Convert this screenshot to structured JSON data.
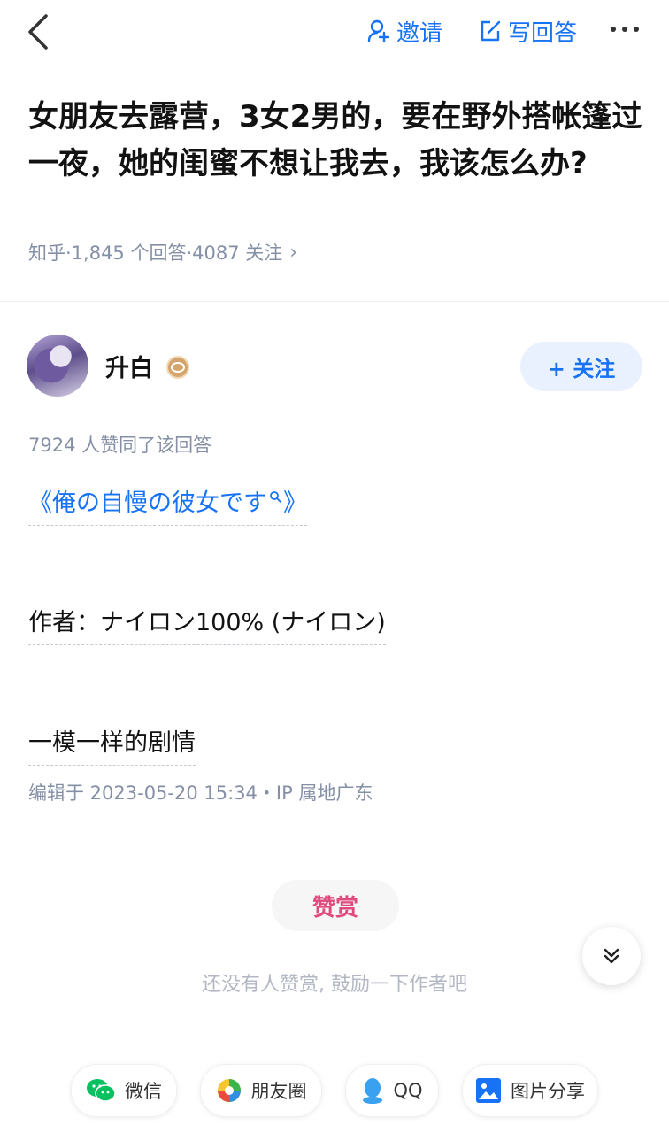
{
  "topbar": {
    "invite_label": "邀请",
    "write_label": "写回答"
  },
  "question": {
    "title": "女朋友去露营，3女2男的，要在野外搭帐篷过一夜，她的闺蜜不想让我去，我该怎么办?",
    "meta": "知乎·1,845 个回答·4087 关注"
  },
  "author": {
    "name": "升白",
    "follow_label": "+ 关注"
  },
  "answer": {
    "votes": "7924 人赞同了该回答",
    "paragraph_1_before": "《俺の自慢の彼女です",
    "paragraph_1_after": "》",
    "paragraph_2": "作者：ナイロン100% (ナイロン)",
    "paragraph_3": "一模一样的剧情",
    "edit_info": "编辑于 2023-05-20 15:34・IP 属地广东"
  },
  "reward": {
    "button_label": "赞赏",
    "hint": "还没有人赞赏, 鼓励一下作者吧"
  },
  "share": {
    "wechat": "微信",
    "moments": "朋友圈",
    "qq": "QQ",
    "image_share": "图片分享"
  },
  "colors": {
    "accent": "#1772F6",
    "reward": "#E0497D",
    "muted": "#8590A6"
  }
}
